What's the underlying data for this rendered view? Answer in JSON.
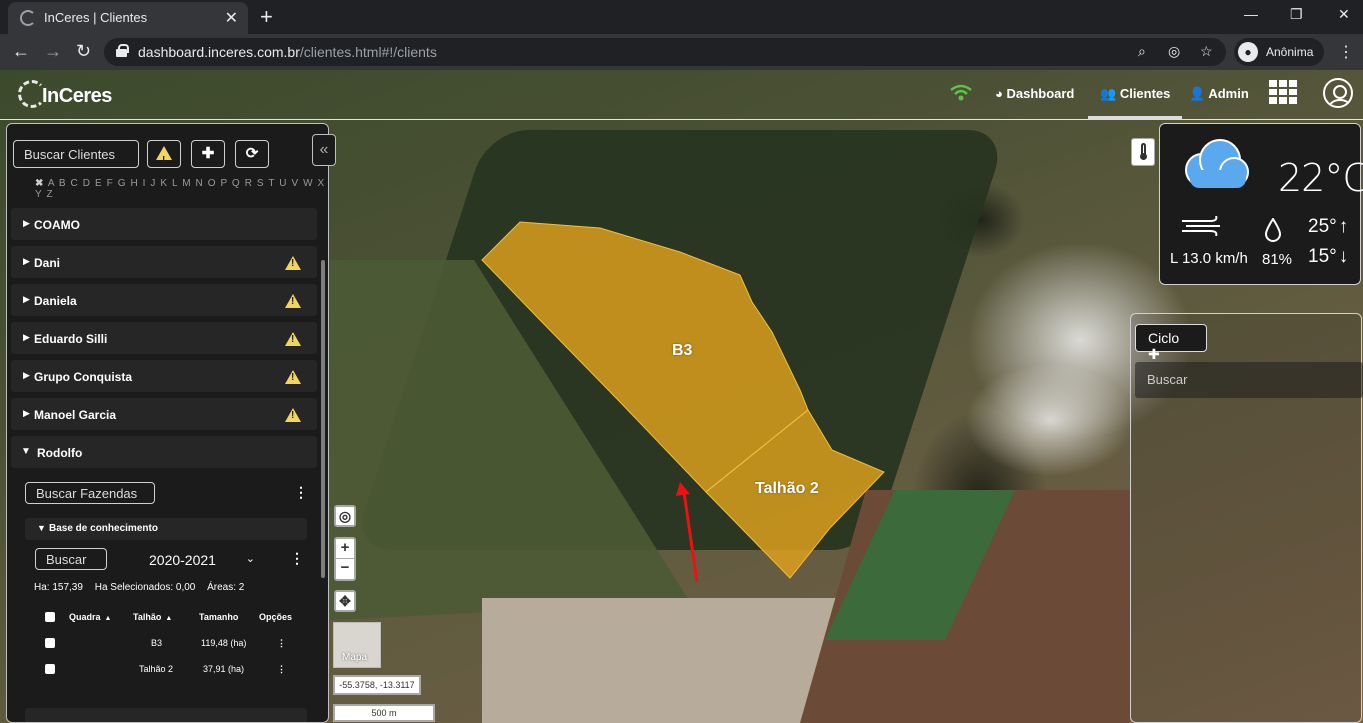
{
  "browser": {
    "tab_title": "InCeres | Clientes",
    "url_host": "dashboard.inceres.com.br",
    "url_path": "/clientes.html#!/clients",
    "profile_label": "Anônima"
  },
  "navbar": {
    "logo_text": "InCeres",
    "links": [
      "Dashboard",
      "Clientes",
      "Admin"
    ]
  },
  "client_panel": {
    "search_placeholder": "Buscar Clientes",
    "alphabet": "A B C D E F G H I J K L M N O P Q R S T U V W X Y Z",
    "clients": [
      {
        "name": "COAMO",
        "warning": false
      },
      {
        "name": "Dani",
        "warning": true
      },
      {
        "name": "Daniela",
        "warning": true
      },
      {
        "name": "Eduardo Silli",
        "warning": true
      },
      {
        "name": "Grupo Conquista",
        "warning": true
      },
      {
        "name": "Manoel Garcia",
        "warning": true
      },
      {
        "name": "Rodolfo",
        "warning": false,
        "expanded": true
      }
    ],
    "farm_search_placeholder": "Buscar Fazendas",
    "farm_name": "Base de conhecimento",
    "buscar_label": "Buscar",
    "season": "2020-2021",
    "stats": {
      "ha": "Ha: 157,39",
      "ha_selected": "Ha Selecionados: 0,00",
      "areas": "Áreas: 2"
    },
    "table": {
      "headers": {
        "quadra": "Quadra",
        "talhao": "Talhão",
        "tamanho": "Tamanho",
        "opcoes": "Opções"
      },
      "rows": [
        {
          "talhao": "B3",
          "tamanho": "119,48 (ha)"
        },
        {
          "talhao": "Talhão 2",
          "tamanho": "37,91 (ha)"
        }
      ]
    }
  },
  "map": {
    "parcels": [
      {
        "name": "B3",
        "color": "#e0a21c"
      },
      {
        "name": "Talhão 2",
        "color": "#e0a21c"
      }
    ],
    "coordinates": "-55.3758, -13.3117",
    "scale": "500 m",
    "basemap_label": "Mapa"
  },
  "weather": {
    "temperature": "22°C",
    "wind": "L 13.0 km/h",
    "humidity": "81%",
    "max": "25°",
    "min": "15°"
  },
  "cycle_panel": {
    "button_label": "Ciclo",
    "search_placeholder": "Buscar"
  },
  "colors": {
    "accent_warning": "#f1d55c",
    "parcel_fill": "#e0a21c",
    "wifi": "#5cc24a",
    "weather_cloud": "#5aa9ee"
  }
}
